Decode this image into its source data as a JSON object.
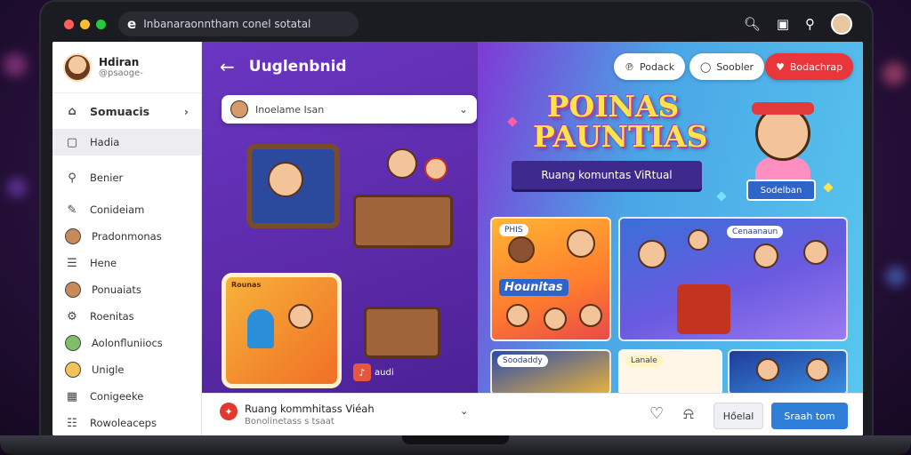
{
  "window": {
    "address_text": "Inbanaraonntham conel sotatal",
    "address_glyph": "e",
    "colors": {
      "close": "#ff5f56",
      "minimize": "#ffbd2e",
      "maximize": "#27c93f"
    }
  },
  "topbar_icons": [
    "search-icon",
    "bookmark-icon",
    "search-icon",
    "avatar"
  ],
  "sidebar": {
    "profile": {
      "name": "Hdiran",
      "handle": "@psaoge-"
    },
    "items": [
      {
        "label": "Somuacis",
        "icon": "home-icon"
      },
      {
        "label": "Hadia",
        "icon": "screen-icon"
      },
      {
        "label": "Benier",
        "icon": "search-icon"
      },
      {
        "label": "Conideiam",
        "icon": "edit-icon"
      },
      {
        "label": "Pradonmonas",
        "icon": "avatar"
      },
      {
        "label": "Hene",
        "icon": "list-icon"
      },
      {
        "label": "Ponuaiats",
        "icon": "avatar"
      },
      {
        "label": "Roenitas",
        "icon": "gear-icon"
      },
      {
        "label": "Aolonfluniiocs",
        "icon": "avatar"
      },
      {
        "label": "Unigle",
        "icon": "avatar"
      },
      {
        "label": "Conigeeke",
        "icon": "grid-icon"
      },
      {
        "label": "Rowoleaceps",
        "icon": "list-icon"
      }
    ]
  },
  "main": {
    "back_icon": "arrow-left-icon",
    "title": "Uuglenbnid",
    "select": {
      "value": "Inoelame Isan"
    },
    "buttons": {
      "left": "Podack",
      "middle": "Soobler",
      "right": "Bodachrap"
    },
    "hero_title": "POINAS PAUNTIAS",
    "hero_subtitle": "Ruang komuntas ViRtual",
    "mascot_button": "Sodelban",
    "card_kid_label": "Rounas",
    "card_kid_badge": "audi",
    "tiles": {
      "tile1_label": "Hounitas",
      "tile1_badge": "PHIS",
      "tile2_badge": "Cenaanaun",
      "tile3_badge": "Soodaddy",
      "tile4_badge": "Lanale"
    }
  },
  "bottom": {
    "post_title": "Ruang kommhitass Viéah",
    "post_sub": "Bonolinetass s tsaat",
    "btn_secondary": "Hőelal",
    "btn_primary": "Sraah tom"
  }
}
